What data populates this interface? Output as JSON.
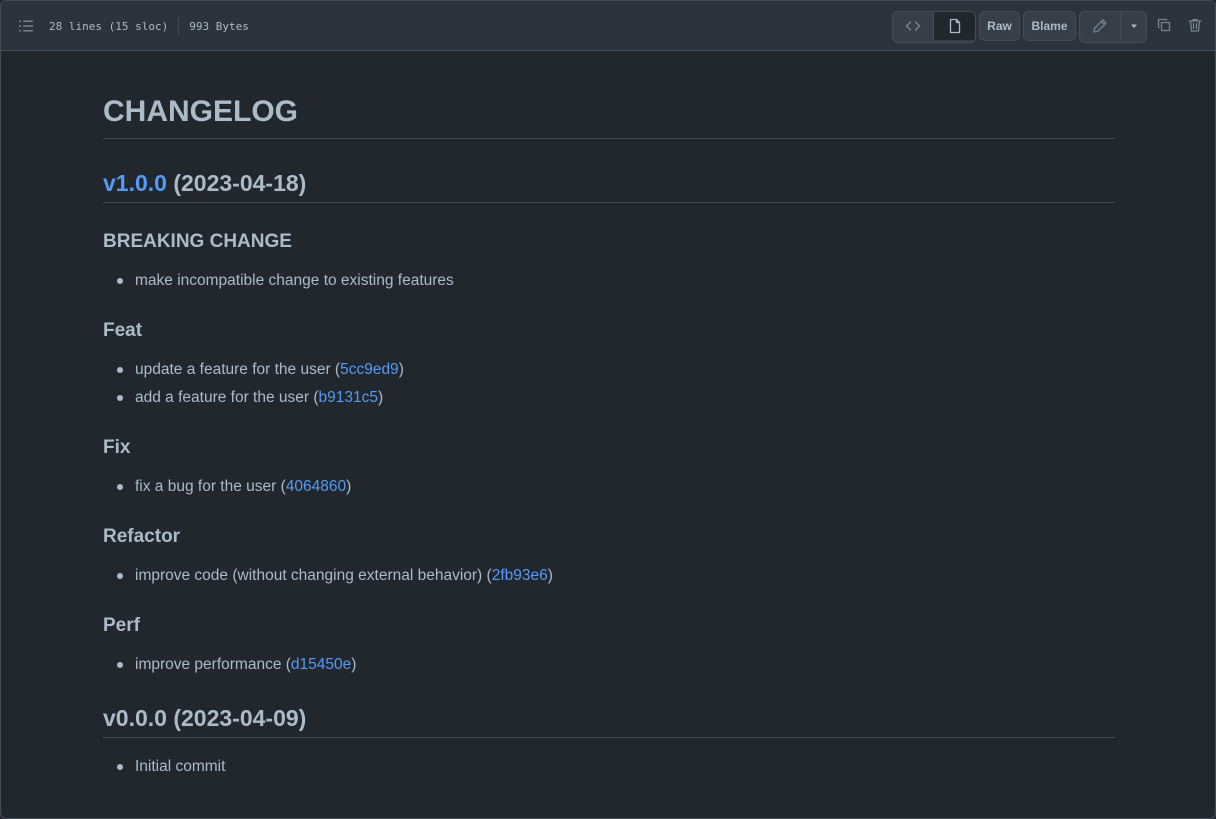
{
  "header": {
    "lines_info": "28 lines (15 sloc)",
    "size_info": "993 Bytes",
    "raw_label": "Raw",
    "blame_label": "Blame"
  },
  "doc": {
    "title": "CHANGELOG",
    "release1": {
      "version_link": "v1.0.0",
      "date": " (2023-04-18)"
    },
    "sections": {
      "breaking": {
        "heading": "BREAKING CHANGE",
        "items": [
          "make incompatible change to existing features"
        ]
      },
      "feat": {
        "heading": "Feat",
        "items": [
          {
            "text": "update a feature for the user (",
            "hash": "5cc9ed9",
            "close": ")"
          },
          {
            "text": "add a feature for the user (",
            "hash": "b9131c5",
            "close": ")"
          }
        ]
      },
      "fix": {
        "heading": "Fix",
        "items": [
          {
            "text": "fix a bug for the user (",
            "hash": "4064860",
            "close": ")"
          }
        ]
      },
      "refactor": {
        "heading": "Refactor",
        "items": [
          {
            "text": "improve code (without changing external behavior) (",
            "hash": "2fb93e6",
            "close": ")"
          }
        ]
      },
      "perf": {
        "heading": "Perf",
        "items": [
          {
            "text": "improve performance (",
            "hash": "d15450e",
            "close": ")"
          }
        ]
      }
    },
    "release0": {
      "heading": "v0.0.0 (2023-04-09)",
      "items": [
        "Initial commit"
      ]
    }
  },
  "colors": {
    "background": "#22272e",
    "header_bg": "#2d333b",
    "border": "#444c56",
    "text": "#adbac7",
    "link": "#539bf5"
  },
  "icons": [
    "list-unordered-icon",
    "code-icon",
    "file-icon",
    "pencil-icon",
    "triangle-down-icon",
    "copy-icon",
    "trash-icon"
  ]
}
